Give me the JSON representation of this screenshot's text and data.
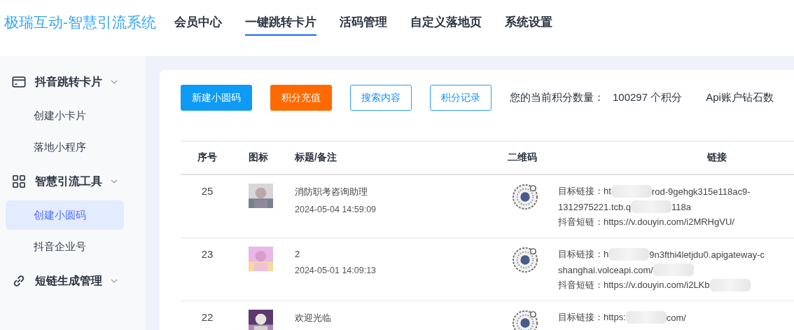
{
  "logo": "极瑞互动-智慧引流系统",
  "nav": [
    {
      "label": "会员中心",
      "selected": false
    },
    {
      "label": "一键跳转卡片",
      "selected": true
    },
    {
      "label": "活码管理",
      "selected": false
    },
    {
      "label": "自定义落地页",
      "selected": false
    },
    {
      "label": "系统设置",
      "selected": false
    }
  ],
  "sidebar": [
    {
      "label": "抖音跳转卡片",
      "kind": "card",
      "children": [
        {
          "label": "创建小卡片",
          "selected": false
        },
        {
          "label": "落地小程序",
          "selected": false
        }
      ]
    },
    {
      "label": "智慧引流工具",
      "kind": "grid",
      "children": [
        {
          "label": "创建小圆码",
          "selected": true
        },
        {
          "label": "抖音企业号",
          "selected": false
        }
      ]
    },
    {
      "label": "短链生成管理",
      "kind": "link"
    }
  ],
  "toolbar": {
    "buttons": [
      {
        "label": "新建小圆码",
        "kind": "primary"
      },
      {
        "label": "积分充值",
        "kind": "warning"
      },
      {
        "label": "搜索内容",
        "kind": "outline"
      },
      {
        "label": "积分记录",
        "kind": "outline"
      }
    ],
    "points_label": "您的当前积分数量：",
    "points_value": "100297 个积分",
    "api_label": "Api账户钻石数"
  },
  "table": {
    "columns": [
      "序号",
      "图标",
      "标题/备注",
      "二维码",
      "链接"
    ],
    "rows": [
      {
        "index": "25",
        "title": "消防职考咨询助理",
        "time": "2024-05-04 14:59:09",
        "links": [
          [
            {
              "kind": "text",
              "text": "目标链接：ht"
            },
            {
              "kind": "redacted"
            },
            {
              "kind": "text",
              "text": "rod-9gehgk315e118ac9-"
            }
          ],
          [
            {
              "kind": "text",
              "text": "1312975221.tcb.q"
            },
            {
              "kind": "redacted"
            },
            {
              "kind": "text",
              "text": "118a"
            }
          ],
          [
            {
              "kind": "text",
              "text": "抖音短链：https://v.douyin.com/i2MRHgVU/"
            }
          ]
        ]
      },
      {
        "index": "23",
        "title": "2",
        "time": "2024-05-01 14:09:13",
        "links": [
          [
            {
              "kind": "text",
              "text": "目标链接：h"
            },
            {
              "kind": "redacted"
            },
            {
              "kind": "text",
              "text": "9n3fthi4letjdu0.apigateway-c"
            }
          ],
          [
            {
              "kind": "text",
              "text": "shanghai.volceapi.com/"
            },
            {
              "kind": "redacted"
            }
          ],
          [
            {
              "kind": "text",
              "text": "抖音短链：https://v.douyin.com/i2LKb"
            },
            {
              "kind": "redacted"
            }
          ]
        ]
      },
      {
        "index": "22",
        "title": "欢迎光临",
        "links": [
          [
            {
              "kind": "text",
              "text": "目标链接：https:"
            },
            {
              "kind": "redacted"
            },
            {
              "kind": "text",
              "text": "com/"
            }
          ]
        ]
      }
    ]
  }
}
